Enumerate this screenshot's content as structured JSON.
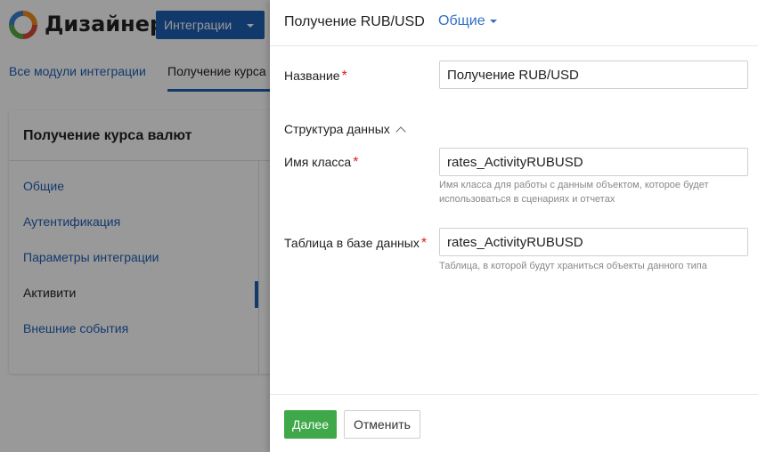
{
  "app": {
    "title": "Дизайнер",
    "integrations_button": "Интеграции"
  },
  "tabs": [
    "Все модули интеграции",
    "Получение курса"
  ],
  "card": {
    "title": "Получение курса валют",
    "menu": [
      "Общие",
      "Аутентификация",
      "Параметры интеграции",
      "Активити",
      "Внешние события"
    ],
    "active_index": 3
  },
  "panel": {
    "title": "Получение RUB/USD",
    "section_selector": "Общие",
    "fields": {
      "name": {
        "label": "Название",
        "value": "Получение RUB/USD"
      },
      "structure_label": "Структура данных",
      "class_name": {
        "label": "Имя класса",
        "value": "rates_ActivityRUBUSD",
        "hint": "Имя класса для работы с данным объектом, которое будет использоваться в сценариях и отчетах"
      },
      "table": {
        "label": "Таблица в базе данных",
        "value": "rates_ActivityRUBUSD",
        "hint": "Таблица, в которой будут храниться объекты данного типа"
      }
    },
    "footer": {
      "next": "Далее",
      "cancel": "Отменить"
    }
  },
  "colors": {
    "primary_blue": "#1f5fb5",
    "link_blue": "#2f6fc5",
    "success_green": "#3fa849",
    "required_red": "#e02020"
  },
  "icons": {
    "logo": "logo-ring-icon",
    "caret": "caret-down-icon",
    "collapse": "chevron-up-icon"
  }
}
